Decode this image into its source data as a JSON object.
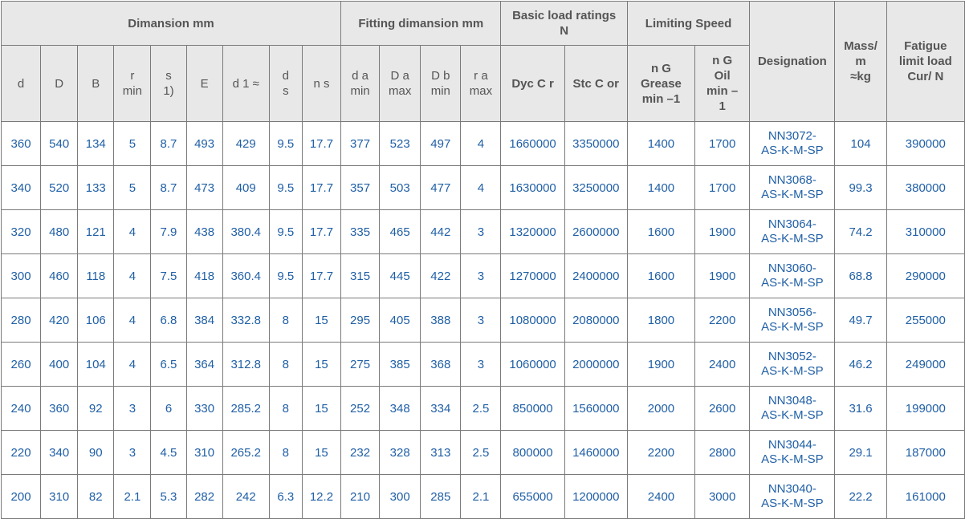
{
  "groups": {
    "dimension": "Dimansion mm",
    "fitting": "Fitting dimansion mm",
    "load_line1": "Basic load ratings",
    "load_line2": "N",
    "speed": "Limiting Speed",
    "designation": "Designation",
    "mass_line1": "Mass/",
    "mass_line2": "m",
    "mass_line3": "≈kg",
    "fatigue_line1": "Fatigue",
    "fatigue_line2": "limit load",
    "fatigue_line3": "Cur/ N"
  },
  "subheaders": {
    "d": "d",
    "D": "D",
    "B": "B",
    "r_1": "r",
    "r_2": "min",
    "s_1": "s",
    "s_2": "1)",
    "E": "E",
    "d1": "d 1 ≈",
    "ds_1": "d",
    "ds_2": "s",
    "ns": "n s",
    "da_1": "d a",
    "da_2": "min",
    "Da_1": "D a",
    "Da_2": "max",
    "Db_1": "D b",
    "Db_2": "min",
    "ra_1": "r a",
    "ra_2": "max",
    "dyn": "Dyc C r",
    "stc": "Stc C or",
    "grease_1": "n G",
    "grease_2": "Grease",
    "grease_3": "min –1",
    "oil_1": "n G",
    "oil_2": "Oil",
    "oil_3": "min –",
    "oil_4": "1"
  },
  "rows": [
    {
      "d": "360",
      "D": "540",
      "B": "134",
      "r": "5",
      "s": "8.7",
      "E": "493",
      "d1": "429",
      "ds": "9.5",
      "ns": "17.7",
      "da": "377",
      "Da": "523",
      "Db": "497",
      "ra": "4",
      "cr": "1660000",
      "cor": "3350000",
      "grease": "1400",
      "oil": "1700",
      "desig1": "NN3072-",
      "desig2": "AS-K-M-SP",
      "mass": "104",
      "fatigue": "390000"
    },
    {
      "d": "340",
      "D": "520",
      "B": "133",
      "r": "5",
      "s": "8.7",
      "E": "473",
      "d1": "409",
      "ds": "9.5",
      "ns": "17.7",
      "da": "357",
      "Da": "503",
      "Db": "477",
      "ra": "4",
      "cr": "1630000",
      "cor": "3250000",
      "grease": "1400",
      "oil": "1700",
      "desig1": "NN3068-",
      "desig2": "AS-K-M-SP",
      "mass": "99.3",
      "fatigue": "380000"
    },
    {
      "d": "320",
      "D": "480",
      "B": "121",
      "r": "4",
      "s": "7.9",
      "E": "438",
      "d1": "380.4",
      "ds": "9.5",
      "ns": "17.7",
      "da": "335",
      "Da": "465",
      "Db": "442",
      "ra": "3",
      "cr": "1320000",
      "cor": "2600000",
      "grease": "1600",
      "oil": "1900",
      "desig1": "NN3064-",
      "desig2": "AS-K-M-SP",
      "mass": "74.2",
      "fatigue": "310000"
    },
    {
      "d": "300",
      "D": "460",
      "B": "118",
      "r": "4",
      "s": "7.5",
      "E": "418",
      "d1": "360.4",
      "ds": "9.5",
      "ns": "17.7",
      "da": "315",
      "Da": "445",
      "Db": "422",
      "ra": "3",
      "cr": "1270000",
      "cor": "2400000",
      "grease": "1600",
      "oil": "1900",
      "desig1": "NN3060-",
      "desig2": "AS-K-M-SP",
      "mass": "68.8",
      "fatigue": "290000"
    },
    {
      "d": "280",
      "D": "420",
      "B": "106",
      "r": "4",
      "s": "6.8",
      "E": "384",
      "d1": "332.8",
      "ds": "8",
      "ns": "15",
      "da": "295",
      "Da": "405",
      "Db": "388",
      "ra": "3",
      "cr": "1080000",
      "cor": "2080000",
      "grease": "1800",
      "oil": "2200",
      "desig1": "NN3056-",
      "desig2": "AS-K-M-SP",
      "mass": "49.7",
      "fatigue": "255000"
    },
    {
      "d": "260",
      "D": "400",
      "B": "104",
      "r": "4",
      "s": "6.5",
      "E": "364",
      "d1": "312.8",
      "ds": "8",
      "ns": "15",
      "da": "275",
      "Da": "385",
      "Db": "368",
      "ra": "3",
      "cr": "1060000",
      "cor": "2000000",
      "grease": "1900",
      "oil": "2400",
      "desig1": "NN3052-",
      "desig2": "AS-K-M-SP",
      "mass": "46.2",
      "fatigue": "249000"
    },
    {
      "d": "240",
      "D": "360",
      "B": "92",
      "r": "3",
      "s": "6",
      "E": "330",
      "d1": "285.2",
      "ds": "8",
      "ns": "15",
      "da": "252",
      "Da": "348",
      "Db": "334",
      "ra": "2.5",
      "cr": "850000",
      "cor": "1560000",
      "grease": "2000",
      "oil": "2600",
      "desig1": "NN3048-",
      "desig2": "AS-K-M-SP",
      "mass": "31.6",
      "fatigue": "199000"
    },
    {
      "d": "220",
      "D": "340",
      "B": "90",
      "r": "3",
      "s": "4.5",
      "E": "310",
      "d1": "265.2",
      "ds": "8",
      "ns": "15",
      "da": "232",
      "Da": "328",
      "Db": "313",
      "ra": "2.5",
      "cr": "800000",
      "cor": "1460000",
      "grease": "2200",
      "oil": "2800",
      "desig1": "NN3044-",
      "desig2": "AS-K-M-SP",
      "mass": "29.1",
      "fatigue": "187000"
    },
    {
      "d": "200",
      "D": "310",
      "B": "82",
      "r": "2.1",
      "s": "5.3",
      "E": "282",
      "d1": "242",
      "ds": "6.3",
      "ns": "12.2",
      "da": "210",
      "Da": "300",
      "Db": "285",
      "ra": "2.1",
      "cr": "655000",
      "cor": "1200000",
      "grease": "2400",
      "oil": "3000",
      "desig1": "NN3040-",
      "desig2": "AS-K-M-SP",
      "mass": "22.2",
      "fatigue": "161000"
    }
  ]
}
